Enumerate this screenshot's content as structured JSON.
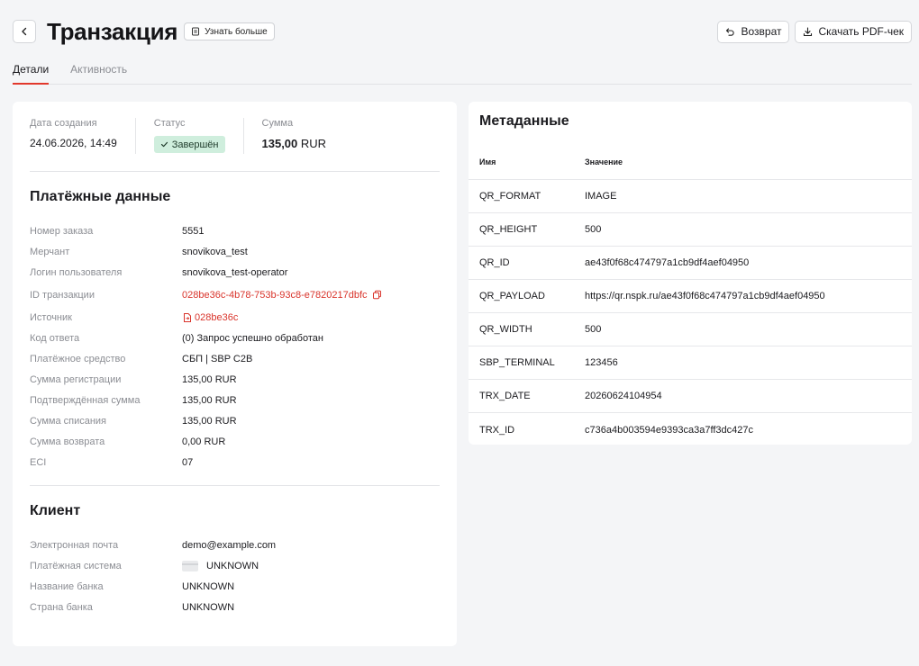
{
  "header": {
    "title": "Транзакция",
    "learn_more": "Узнать больше",
    "refund_label": "Возврат",
    "download_label": "Скачать PDF-чек"
  },
  "tabs": [
    {
      "label": "Детали",
      "active": true
    },
    {
      "label": "Активность",
      "active": false
    }
  ],
  "summary": {
    "created_label": "Дата создания",
    "created_value": "24.06.2026, 14:49",
    "status_label": "Статус",
    "status_value": "Завершён",
    "amount_label": "Сумма",
    "amount_number": "135,00",
    "amount_currency": "RUR"
  },
  "payment": {
    "title": "Платёжные данные",
    "rows": [
      {
        "label": "Номер заказа",
        "value": "5551"
      },
      {
        "label": "Мерчант",
        "value": "snovikova_test"
      },
      {
        "label": "Логин пользователя",
        "value": "snovikova_test-operator"
      },
      {
        "label": "ID транзакции",
        "value": "028be36c-4b78-753b-93c8-e7820217dbfc"
      },
      {
        "label": "Источник",
        "value": "028be36c"
      },
      {
        "label": "Код ответа",
        "value": "(0) Запрос успешно обработан"
      },
      {
        "label": "Платёжное средство",
        "value": "СБП | SBP C2B"
      },
      {
        "label": "Сумма регистрации",
        "value": "135,00 RUR"
      },
      {
        "label": "Подтверждённая сумма",
        "value": "135,00 RUR"
      },
      {
        "label": "Сумма списания",
        "value": "135,00 RUR"
      },
      {
        "label": "Сумма возврата",
        "value": "0,00 RUR"
      },
      {
        "label": "ECI",
        "value": "07"
      }
    ]
  },
  "client": {
    "title": "Клиент",
    "rows": [
      {
        "label": "Электронная почта",
        "value": "demo@example.com"
      },
      {
        "label": "Платёжная система",
        "value": "UNKNOWN"
      },
      {
        "label": "Название банка",
        "value": "UNKNOWN"
      },
      {
        "label": "Страна банка",
        "value": "UNKNOWN"
      }
    ]
  },
  "metadata": {
    "title": "Метаданные",
    "col_name": "Имя",
    "col_value": "Значение",
    "rows": [
      {
        "name": "QR_FORMAT",
        "value": "IMAGE"
      },
      {
        "name": "QR_HEIGHT",
        "value": "500"
      },
      {
        "name": "QR_ID",
        "value": "ae43f0f68c474797a1cb9df4aef04950"
      },
      {
        "name": "QR_PAYLOAD",
        "value": "https://qr.nspk.ru/ae43f0f68c474797a1cb9df4aef04950"
      },
      {
        "name": "QR_WIDTH",
        "value": "500"
      },
      {
        "name": "SBP_TERMINAL",
        "value": "123456"
      },
      {
        "name": "TRX_DATE",
        "value": "20260624104954"
      },
      {
        "name": "TRX_ID",
        "value": "c736a4b003594e9393ca3a7ff3dc427c"
      }
    ]
  },
  "colors": {
    "accent": "#e2382c",
    "link": "#d9342b",
    "status_bg": "#cfeedd"
  },
  "icons": [
    "chevron-left-icon",
    "info-doc-icon",
    "undo-icon",
    "download-icon",
    "check-icon",
    "copy-icon",
    "document-link-icon",
    "card-icon"
  ]
}
